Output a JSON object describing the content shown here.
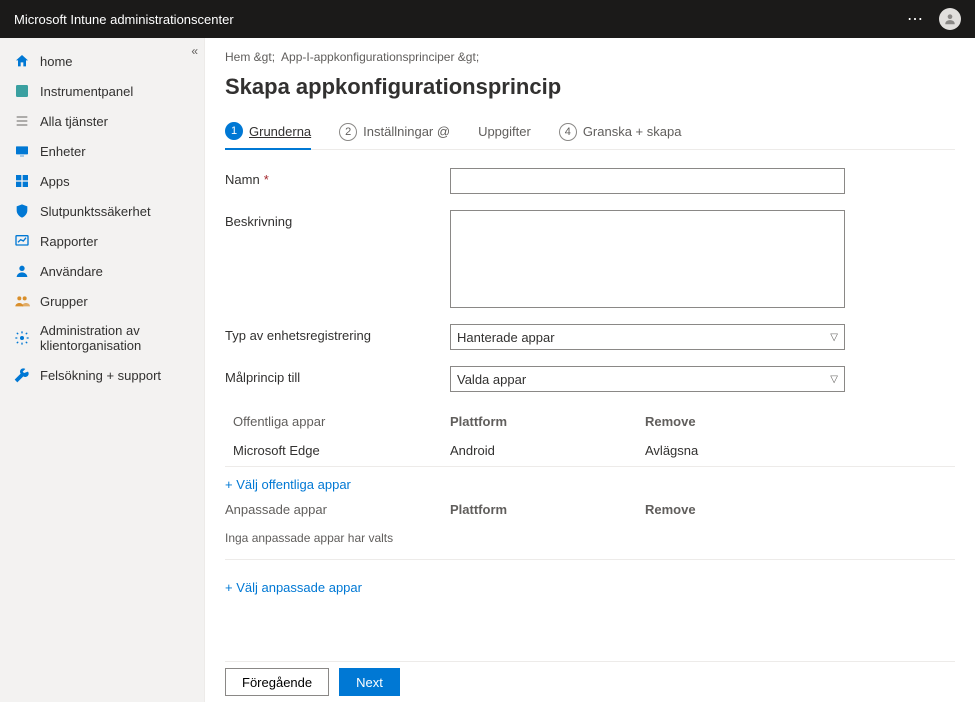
{
  "header": {
    "title": "Microsoft Intune administrationscenter"
  },
  "sidebar": {
    "items": [
      {
        "label": "home",
        "icon": "home",
        "color": "#0078d4"
      },
      {
        "label": "Instrumentpanel",
        "icon": "dashboard",
        "color": "#0078d4"
      },
      {
        "label": "Alla tjänster",
        "icon": "list",
        "color": "#8a8886"
      },
      {
        "label": "Enheter",
        "icon": "device",
        "color": "#0078d4"
      },
      {
        "label": "Apps",
        "icon": "apps",
        "color": "#0078d4"
      },
      {
        "label": "Slutpunktssäkerhet",
        "icon": "shield",
        "color": "#0078d4"
      },
      {
        "label": "Rapporter",
        "icon": "reports",
        "color": "#0078d4"
      },
      {
        "label": "Användare",
        "icon": "user",
        "color": "#0078d4"
      },
      {
        "label": "Grupper",
        "icon": "group",
        "color": "#0078d4"
      },
      {
        "label": "Administration av klientorganisation",
        "icon": "admin",
        "color": "#0078d4"
      },
      {
        "label": "Felsökning + support",
        "icon": "wrench",
        "color": "#0078d4"
      }
    ]
  },
  "breadcrumb": {
    "sep": " > ",
    "items": [
      "Hem",
      "App-I-appkonfigurationsprinciper",
      ""
    ]
  },
  "page": {
    "title": "Skapa appkonfigurationsprincip"
  },
  "steps": [
    {
      "num": "1",
      "label": "Grunderna",
      "active": true
    },
    {
      "num": "2",
      "label": "Inställningar @",
      "active": false
    },
    {
      "num": "",
      "label": "Uppgifter",
      "active": false
    },
    {
      "num": "4",
      "label": "Granska + skapa",
      "active": false
    }
  ],
  "form": {
    "name_label": "Namn",
    "name_value": "",
    "desc_label": "Beskrivning",
    "desc_value": "",
    "devreg_label": "Typ av enhetsregistrering",
    "devreg_value": "Hanterade appar",
    "target_label": "Målprincip till",
    "target_value": "Valda appar"
  },
  "public_apps": {
    "header": {
      "c1": "Offentliga appar",
      "c2": "Plattform",
      "c3": "Remove"
    },
    "rows": [
      {
        "c1": "Microsoft Edge",
        "c2": "Android",
        "c3": "Avlägsna"
      }
    ],
    "add_link": "+ Välj offentliga appar"
  },
  "custom_apps": {
    "header": {
      "c1": "Anpassade appar",
      "c2": "Plattform",
      "c3": "Remove"
    },
    "empty": "Inga anpassade appar har valts",
    "add_link": "+ Välj anpassade appar"
  },
  "footer": {
    "prev": "Föregående",
    "next": "Next"
  }
}
